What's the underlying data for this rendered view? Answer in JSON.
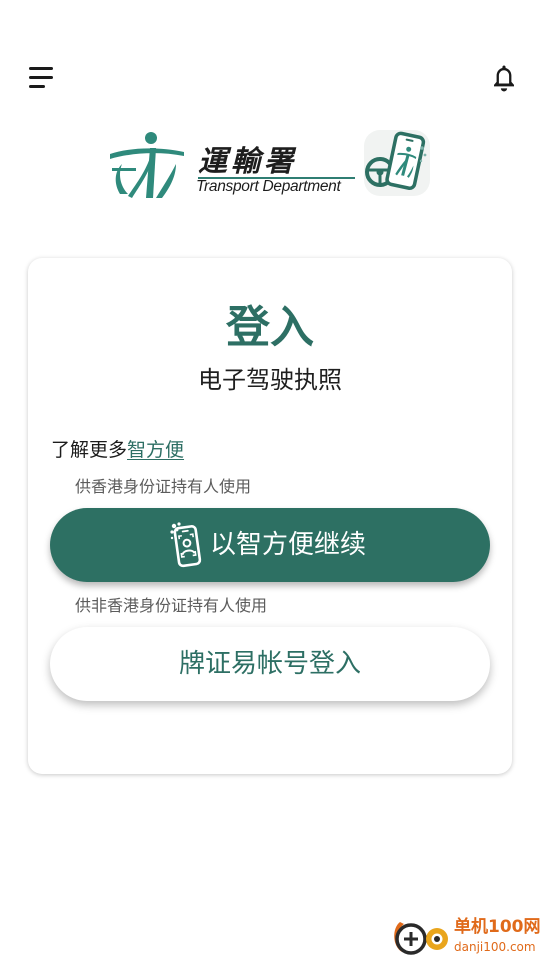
{
  "header": {
    "menu_icon": "menu-icon",
    "notification_icon": "bell-icon"
  },
  "logo": {
    "chinese_name": "運輸署",
    "english_name": "Transport Department",
    "app_icon": "edriving-licence-app-icon"
  },
  "login": {
    "title": "登入",
    "subtitle": "电子驾驶执照",
    "learn_more_prefix": "了解更多",
    "learn_more_link": "智方便",
    "hk_id_hint": "供香港身份证持有人使用",
    "iamsmart_button_label": "以智方便继续",
    "iamsmart_icon": "iamsmart-phone-icon",
    "non_hk_id_hint": "供非香港身份证持有人使用",
    "account_button_label": "牌证易帐号登入"
  },
  "watermark": {
    "name": "单机100网",
    "url": "danji100.com"
  },
  "colors": {
    "primary": "#2d7063",
    "primary_text": "#2d6f64",
    "watermark": "#e06a1a"
  }
}
